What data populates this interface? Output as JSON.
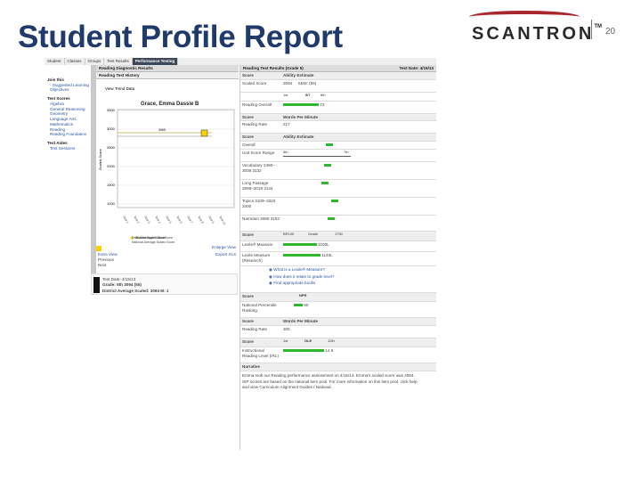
{
  "slide": {
    "title": "Student Profile Report",
    "page_number": "20"
  },
  "logo": {
    "name": "SCANTRON",
    "tm": "TM"
  },
  "tabs": [
    "Student",
    "Classes",
    "Groups",
    "Test Results",
    "Performance Testing"
  ],
  "sidebar": {
    "h1": "Join this",
    "i1a": "- Suggested Learning",
    "i1b": "Objectives",
    "h2": "Test Scores",
    "items": [
      "Algebra",
      "General Reasoning",
      "Geometry",
      "Language Arts",
      "Mathematics",
      "Reading",
      "Reading Foundation"
    ],
    "h3": "Test Aides",
    "i3": "Test Sessions"
  },
  "graph": {
    "header": "Reading Diagnostic Results",
    "sub": "Reading Test History",
    "sub2": "View Trend Data",
    "title": "Grace, Emma Dassie B",
    "yaxis": "Scaled Score",
    "yticks": [
      "3500",
      "3000",
      "2500",
      "2000",
      "1500",
      "1000"
    ],
    "mid": "3065",
    "legend": [
      "Student Scaled Score",
      "District Average Scaled Score",
      "National Average Scaled Score"
    ],
    "enlarge": "Enlarge View",
    "export": "Export XLS",
    "nav": [
      "Extra View",
      "Previous",
      "Next"
    ]
  },
  "summary": {
    "l1": "Test Date: 4/15/13",
    "l2": "Grade: 5th  3094  (55)",
    "l3": "District Average Scaled:  3094  M: 1"
  },
  "right": {
    "h1": "Reading Test Results (Grade 5)",
    "date": "Test Date: 4/15/13",
    "score": "Score",
    "ability": "Ability Estimate",
    "scaled_lbl": "Scaled Score",
    "scaled_val": "3094",
    "sem": "SEM: (55)",
    "gl": [
      "1st",
      "5th",
      "6th"
    ],
    "gl_marker": "5/7",
    "overall_lbl": "Reading Overall",
    "overall_val": "73",
    "wpm": "Words Per Minute",
    "wpm_lbl": "Reading Rate",
    "wpm_val": "217",
    "ability2": "Ability Estimate",
    "overall2": "Overall",
    "range": [
      "3th",
      "7th"
    ],
    "unit_lbl": "Unit Score Range",
    "units": [
      [
        "Vocabulary 2460–3039 3132",
        26
      ],
      [
        "Long Passage 2899–3019 3144",
        20
      ],
      [
        "Topics 3109–3320 3400",
        22
      ],
      [
        "Narration 3085 3162",
        18
      ]
    ],
    "lex_ticks": [
      "BR100",
      "Grade",
      "1750"
    ],
    "lexile_lbl": "Lexile® Measure",
    "lexile_val": "1100L",
    "lexile2_lbl": "Lexile Measure (Research)",
    "lexile2_val": "1140L",
    "links": [
      "What is a Lexile® Measure?",
      "How does it relate to grade level?",
      "Find appropriate books"
    ],
    "npr_h": "Score",
    "npr": "NPR",
    "npr_lbl": "National Percentile Ranking",
    "npr_val": "90",
    "wpm2": "Words Per Minute",
    "rate2_lbl": "Reading Rate",
    "rate2_val": "305",
    "ole_ticks": [
      "1st",
      "OLE",
      "12th"
    ],
    "ole_lbl": "Instructional Reading Level (IRL)",
    "ole_val": "14.9",
    "narr_h": "Narrative",
    "narr1": "Emma took our Reading performance assessment on 4/15/13. Emma's scaled score was 3094.",
    "narr2": "SIP scores are based on the national item pool. For more information on this item pool, click help",
    "narr3": "and view Curriculum Alignment Guides / National."
  },
  "colors": {
    "title": "#1f3a6b",
    "brand_red": "#a8262d",
    "bar_green": "#2eb82e",
    "tab_active": "#3c4858"
  }
}
